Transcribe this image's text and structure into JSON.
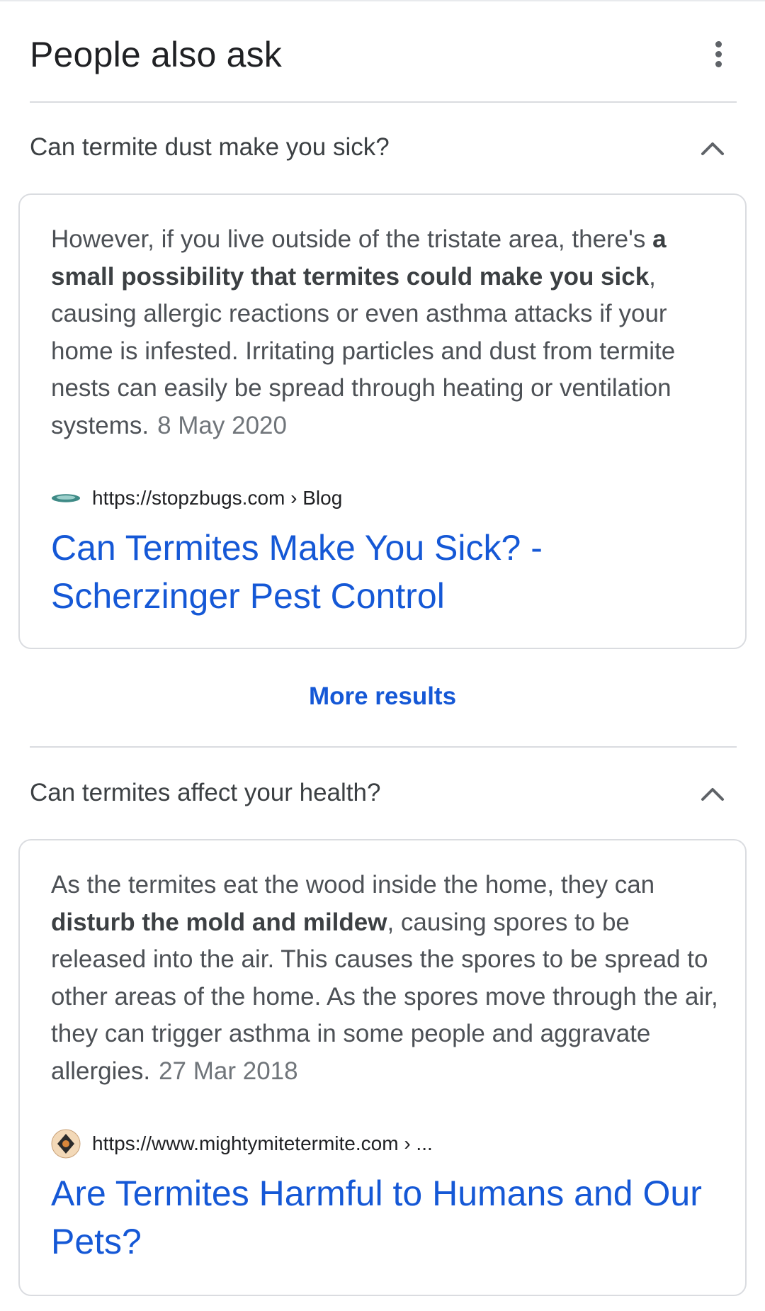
{
  "header": {
    "title": "People also ask",
    "menu_icon": "more-vert-icon"
  },
  "questions": [
    {
      "question": "Can termite dust make you sick?",
      "expanded": true,
      "answer": {
        "pre": "However, if you live outside of the tristate area, there's ",
        "bold": "a small possibility that termites could make you sick",
        "post": ", causing allergic reactions or even asthma attacks if your home is infested. Irritating particles and dust from termite nests can easily be spread through heating or ventilation systems.",
        "date": "8 May 2020"
      },
      "source_url": "https://stopzbugs.com › Blog",
      "link_title": "Can Termites Make You Sick? - Scherzinger Pest Control"
    },
    {
      "question": "Can termites affect your health?",
      "expanded": true,
      "answer": {
        "pre": "As the termites eat the wood inside the home, they can ",
        "bold": "disturb the mold and mildew",
        "post": ", causing spores to be released into the air. This causes the spores to be spread to other areas of the home. As the spores move through the air, they can trigger asthma in some people and aggravate allergies.",
        "date": "27 Mar 2018"
      },
      "source_url": "https://www.mightymitetermite.com › ...",
      "link_title": "Are Termites Harmful to Humans and Our Pets?"
    }
  ],
  "more_results_label": "More results",
  "colors": {
    "link": "#1558d6",
    "text": "#4d5156",
    "divider": "#dadce0"
  }
}
